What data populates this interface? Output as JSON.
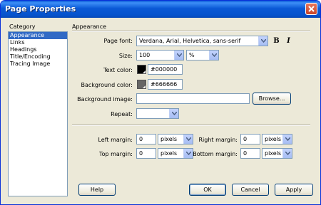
{
  "window": {
    "title": "Page Properties"
  },
  "category": {
    "heading": "Category",
    "items": [
      {
        "label": "Appearance",
        "selected": true
      },
      {
        "label": "Links",
        "selected": false
      },
      {
        "label": "Headings",
        "selected": false
      },
      {
        "label": "Title/Encoding",
        "selected": false
      },
      {
        "label": "Tracing Image",
        "selected": false
      }
    ]
  },
  "appearance": {
    "heading": "Appearance",
    "page_font_label": "Page font:",
    "page_font_value": "Verdana, Arial, Helvetica, sans-serif",
    "bold_label": "B",
    "italic_label": "I",
    "size_label": "Size:",
    "size_value": "100",
    "size_unit": "%",
    "text_color_label": "Text color:",
    "text_color_value": "#000000",
    "bg_color_label": "Background color:",
    "bg_color_value": "#666666",
    "bg_image_label": "Background image:",
    "bg_image_value": "",
    "browse_label": "Browse...",
    "repeat_label": "Repeat:",
    "repeat_value": ""
  },
  "margins": {
    "left_label": "Left margin:",
    "left_value": "0",
    "left_unit": "pixels",
    "right_label": "Right margin:",
    "right_value": "0",
    "right_unit": "pixels",
    "top_label": "Top margin:",
    "top_value": "0",
    "top_unit": "pixels",
    "bottom_label": "Bottom margin:",
    "bottom_value": "0",
    "bottom_unit": "pixels"
  },
  "buttons": {
    "help": "Help",
    "ok": "OK",
    "cancel": "Cancel",
    "apply": "Apply"
  },
  "colors": {
    "text_swatch": "#000000",
    "bg_swatch": "#666666"
  }
}
